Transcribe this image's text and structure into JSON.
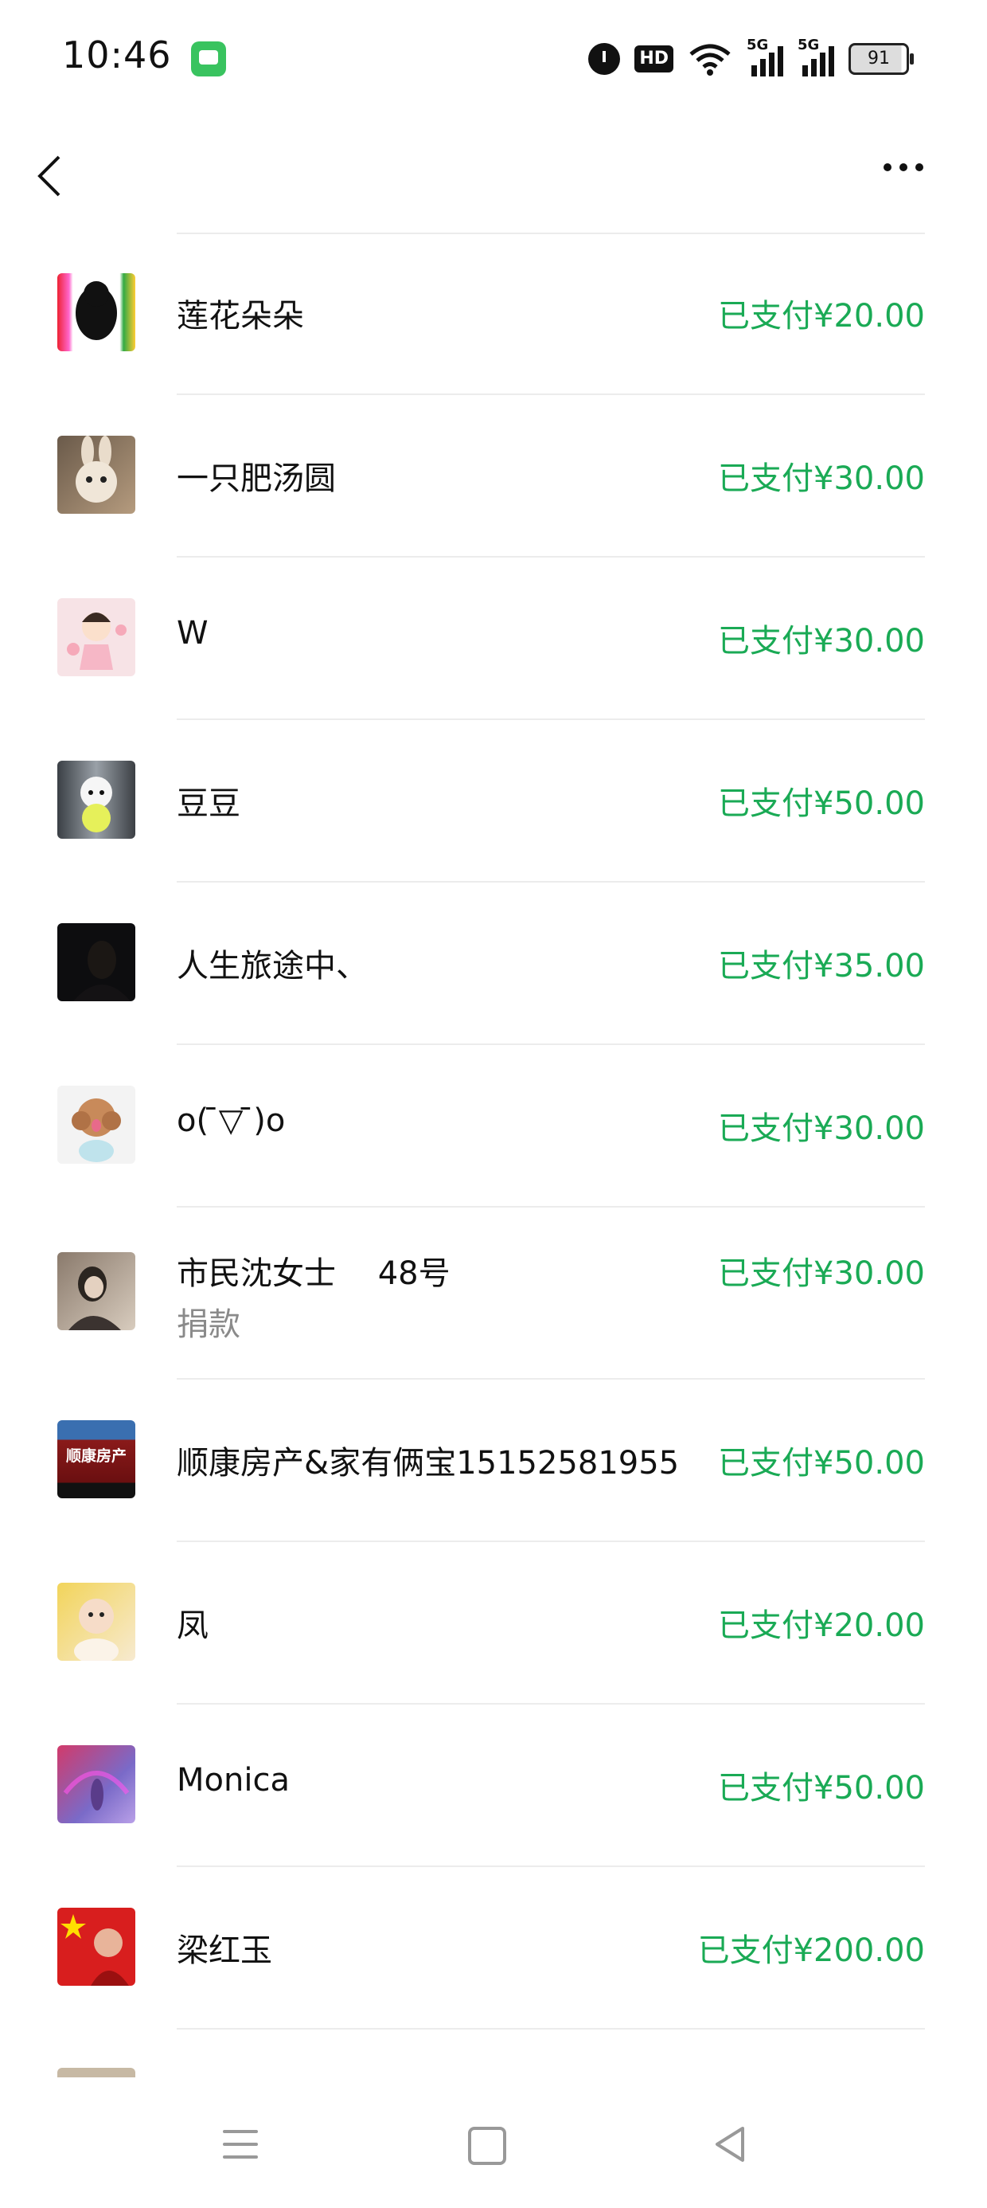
{
  "status_bar": {
    "time": "10:46",
    "hd": "HD",
    "signal1": "5G",
    "signal2": "5G",
    "battery": "91"
  },
  "colors": {
    "amount": "#1aaa55",
    "divider": "#ececec"
  },
  "rows": [
    {
      "name": "莲花朵朵",
      "amount": "已支付¥20.00",
      "avatar": "poodle-avatar"
    },
    {
      "name": "一只肥汤圆",
      "amount": "已支付¥30.00",
      "avatar": "rabbit-avatar"
    },
    {
      "name": "W",
      "amount": "已支付¥30.00",
      "avatar": "cartoon-girl-avatar"
    },
    {
      "name": "豆豆",
      "amount": "已支付¥50.00",
      "avatar": "white-dog-avatar"
    },
    {
      "name": "人生旅途中、",
      "amount": "已支付¥35.00",
      "avatar": "dark-portrait-avatar"
    },
    {
      "name": "o( ̄▽ ̄)o",
      "amount": "已支付¥30.00",
      "avatar": "brown-poodle-avatar"
    },
    {
      "name": "市民沈女士　 48号",
      "note": "捐款",
      "amount": "已支付¥30.00",
      "avatar": "woman-avatar"
    },
    {
      "name": "顺康房产&家有俩宝15152581955",
      "amount": "已支付¥50.00",
      "avatar": "storefront-avatar",
      "avatar_text": "顺康房产"
    },
    {
      "name": "凤",
      "amount": "已支付¥20.00",
      "avatar": "baby-avatar"
    },
    {
      "name": "Monica",
      "amount": "已支付¥50.00",
      "avatar": "pink-scene-avatar"
    },
    {
      "name": "梁红玉",
      "amount": "已支付¥200.00",
      "avatar": "flag-avatar"
    }
  ]
}
